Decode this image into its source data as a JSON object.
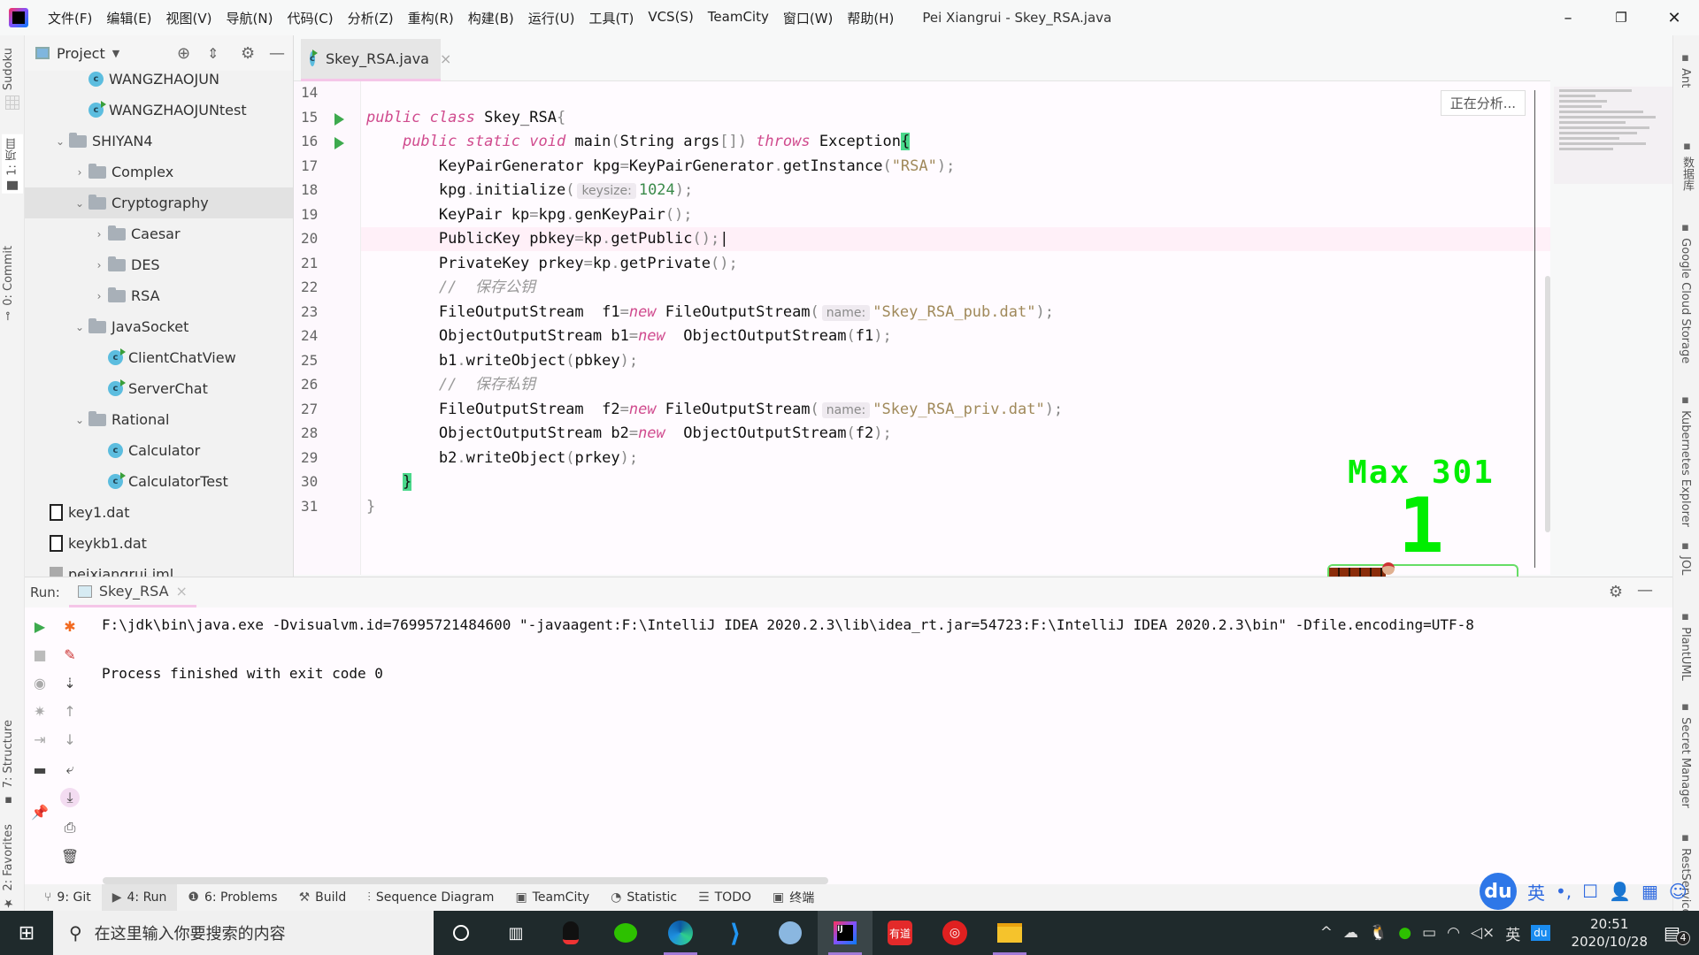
{
  "menu": [
    "文件(F)",
    "编辑(E)",
    "视图(V)",
    "导航(N)",
    "代码(C)",
    "分析(Z)",
    "重构(R)",
    "构建(B)",
    "运行(U)",
    "工具(T)",
    "VCS(S)",
    "TeamCity",
    "窗口(W)",
    "帮助(H)"
  ],
  "window_title": "Pei Xiangrui - Skey_RSA.java",
  "window_controls": {
    "minimize": "–",
    "maximize": "❐",
    "close": "✕"
  },
  "left_strip": {
    "sudoku": "Sudoku",
    "project": "1: 项目",
    "commit": "0: Commit",
    "structure": "7: Structure",
    "favorites": "2: Favorites"
  },
  "project_panel": {
    "title": "Project",
    "tree": [
      {
        "label": "WANGZHAOJUN",
        "type": "class",
        "depth": 3
      },
      {
        "label": "WANGZHAOJUNtest",
        "type": "class-run",
        "depth": 3
      },
      {
        "label": "SHIYAN4",
        "type": "folder",
        "depth": 2,
        "expanded": true
      },
      {
        "label": "Complex",
        "type": "folder",
        "depth": 3,
        "expanded": false
      },
      {
        "label": "Cryptography",
        "type": "folder",
        "depth": 3,
        "expanded": true,
        "selected": true
      },
      {
        "label": "Caesar",
        "type": "folder",
        "depth": 4,
        "expanded": false
      },
      {
        "label": "DES",
        "type": "folder",
        "depth": 4,
        "expanded": false
      },
      {
        "label": "RSA",
        "type": "folder",
        "depth": 4,
        "expanded": false
      },
      {
        "label": "JavaSocket",
        "type": "folder",
        "depth": 3,
        "expanded": true
      },
      {
        "label": "ClientChatView",
        "type": "class-run",
        "depth": 4
      },
      {
        "label": "ServerChat",
        "type": "class-run",
        "depth": 4
      },
      {
        "label": "Rational",
        "type": "folder",
        "depth": 3,
        "expanded": true
      },
      {
        "label": "Calculator",
        "type": "class",
        "depth": 4
      },
      {
        "label": "CalculatorTest",
        "type": "class-run",
        "depth": 4
      },
      {
        "label": "key1.dat",
        "type": "file",
        "depth": 1
      },
      {
        "label": "keykb1.dat",
        "type": "file",
        "depth": 1
      },
      {
        "label": "peixiangrui.iml",
        "type": "iml",
        "depth": 1
      }
    ]
  },
  "editor": {
    "tab_label": "Skey_RSA.java",
    "analyzing_label": "正在分析...",
    "current_line": 20,
    "lines": [
      {
        "n": "14",
        "run": false,
        "html": ""
      },
      {
        "n": "15",
        "run": true,
        "html": "<span class=\"kw\">public class</span> Skey_RSA<span class=\"pun\">{</span>"
      },
      {
        "n": "16",
        "run": true,
        "html": "    <span class=\"kw\">public static void</span> main<span class=\"pun\">(</span>String args<span class=\"pun\">[])</span> <span class=\"kw\">throws</span> Exception<span class=\"brace-hl\">{</span>"
      },
      {
        "n": "17",
        "run": false,
        "html": "        KeyPairGenerator kpg<span class=\"pun\">=</span>KeyPairGenerator<span class=\"pun\">.</span>getInstance<span class=\"pun\">(</span><span class=\"str\">\"RSA\"</span><span class=\"pun\">);</span>"
      },
      {
        "n": "18",
        "run": false,
        "html": "        kpg<span class=\"pun\">.</span>initialize<span class=\"pun\">(</span><span class=\"hint\">keysize:</span><span class=\"num\">1024</span><span class=\"pun\">);</span>"
      },
      {
        "n": "19",
        "run": false,
        "html": "        KeyPair kp<span class=\"pun\">=</span>kpg<span class=\"pun\">.</span>genKeyPair<span class=\"pun\">();</span>"
      },
      {
        "n": "20",
        "run": false,
        "html": "        PublicKey pbkey<span class=\"pun\">=</span>kp<span class=\"pun\">.</span>getPublic<span class=\"pun\">();</span>|"
      },
      {
        "n": "21",
        "run": false,
        "html": "        PrivateKey prkey<span class=\"pun\">=</span>kp<span class=\"pun\">.</span>getPrivate<span class=\"pun\">();</span>"
      },
      {
        "n": "22",
        "run": false,
        "html": "        <span class=\"cmt\">//  保存公钥</span>"
      },
      {
        "n": "23",
        "run": false,
        "html": "        FileOutputStream  f1<span class=\"pun\">=</span><span class=\"kw\">new</span> FileOutputStream<span class=\"pun\">(</span><span class=\"hint\">name:</span><span class=\"str\">\"Skey_RSA_pub.dat\"</span><span class=\"pun\">);</span>"
      },
      {
        "n": "24",
        "run": false,
        "html": "        ObjectOutputStream b1<span class=\"pun\">=</span><span class=\"kw\">new</span>  ObjectOutputStream<span class=\"pun\">(</span>f1<span class=\"pun\">);</span>"
      },
      {
        "n": "25",
        "run": false,
        "html": "        b1<span class=\"pun\">.</span>writeObject<span class=\"pun\">(</span>pbkey<span class=\"pun\">);</span>"
      },
      {
        "n": "26",
        "run": false,
        "html": "        <span class=\"cmt\">//  保存私钥</span>"
      },
      {
        "n": "27",
        "run": false,
        "html": "        FileOutputStream  f2<span class=\"pun\">=</span><span class=\"kw\">new</span> FileOutputStream<span class=\"pun\">(</span><span class=\"hint\">name:</span><span class=\"str\">\"Skey_RSA_priv.dat\"</span><span class=\"pun\">);</span>"
      },
      {
        "n": "28",
        "run": false,
        "html": "        ObjectOutputStream b2<span class=\"pun\">=</span><span class=\"kw\">new</span>  ObjectOutputStream<span class=\"pun\">(</span>f2<span class=\"pun\">);</span>"
      },
      {
        "n": "29",
        "run": false,
        "html": "        b2<span class=\"pun\">.</span>writeObject<span class=\"pun\">(</span>prkey<span class=\"pun\">);</span>"
      },
      {
        "n": "30",
        "run": false,
        "html": "    <span class=\"brace-hl\">}</span>"
      },
      {
        "n": "31",
        "run": false,
        "html": "<span class=\"pun\">}</span>"
      }
    ]
  },
  "game_overlay": {
    "max_label": "Max 301",
    "score": "1",
    "progress_fraction": 0.3
  },
  "right_strip": [
    "Ant",
    "数据库",
    "Google Cloud Storage",
    "Kubernetes Explorer",
    "JOL",
    "PlantUML",
    "Secret Manager",
    "RestServices"
  ],
  "run_panel": {
    "label": "Run:",
    "tab_label": "Skey_RSA",
    "console": [
      "F:\\jdk\\bin\\java.exe -Dvisualvm.id=76995721484600 \"-javaagent:F:\\IntelliJ IDEA 2020.2.3\\lib\\idea_rt.jar=54723:F:\\IntelliJ IDEA 2020.2.3\\bin\" -Dfile.encoding=UTF-8",
      "",
      "Process finished with exit code 0"
    ]
  },
  "bottom_tools": [
    {
      "label": "9: Git",
      "icon": "git-icon"
    },
    {
      "label": "4: Run",
      "icon": "run-icon",
      "active": true
    },
    {
      "label": "6: Problems",
      "icon": "problems-icon"
    },
    {
      "label": "Build",
      "icon": "hammer-icon"
    },
    {
      "label": "Sequence Diagram",
      "icon": "sequence-icon"
    },
    {
      "label": "TeamCity",
      "icon": "teamcity-icon"
    },
    {
      "label": "Statistic",
      "icon": "statistic-icon"
    },
    {
      "label": "TODO",
      "icon": "todo-icon"
    },
    {
      "label": "终端",
      "icon": "terminal-icon"
    }
  ],
  "ime": {
    "logo": "du",
    "mode": "英",
    "punct": "•,"
  },
  "taskbar": {
    "search_placeholder": "在这里输入你要搜索的内容",
    "time": "20:51",
    "date": "2020/10/28",
    "notifications": "4",
    "tray_lang": "英"
  }
}
